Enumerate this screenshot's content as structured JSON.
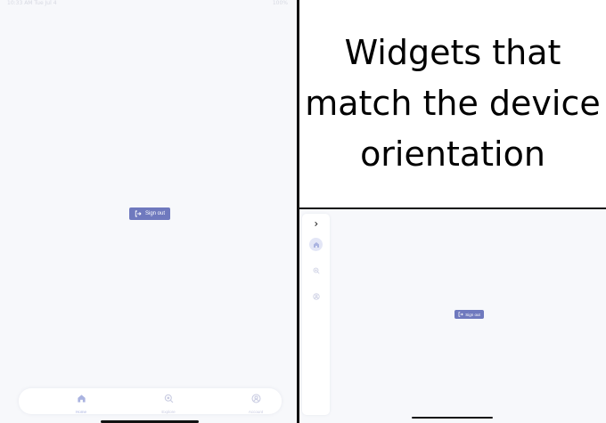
{
  "status_bar": {
    "left": "10:33 AM  Tue Jul 4",
    "right": "100%"
  },
  "portrait": {
    "signout_label": "Sign out",
    "nav": {
      "home_label": "Home",
      "explore_label": "Explore",
      "account_label": "Account",
      "active": "home"
    }
  },
  "caption": {
    "line1": "Widgets that",
    "line2": "match the device",
    "line3": "orientation"
  },
  "landscape": {
    "signout_label": "Sign out",
    "rail": {
      "toggle_icon": "chevron-right-icon",
      "items": [
        "home-icon",
        "explore-icon",
        "account-icon"
      ],
      "active": "home"
    }
  },
  "colors": {
    "accent": "#6f79be",
    "background": "#f7f8fb",
    "nav_inactive": "#c8cbe1",
    "nav_active": "#aab3e0"
  }
}
